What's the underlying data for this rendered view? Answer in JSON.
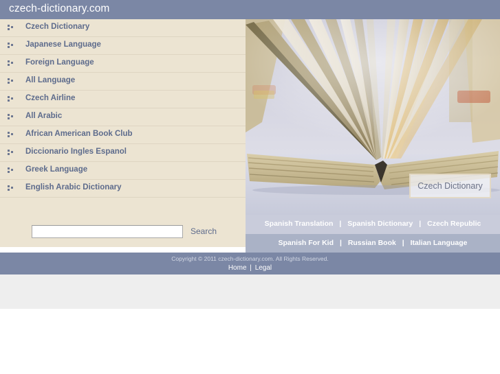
{
  "header": {
    "site_title": "czech-dictionary.com",
    "bar_color": "#7b87a5"
  },
  "sidebar": {
    "background_color": "#ece4d2",
    "bullet_icon": "three-squares-bullet-icon",
    "items": [
      {
        "label": "Czech Dictionary"
      },
      {
        "label": "Japanese Language"
      },
      {
        "label": "Foreign Language"
      },
      {
        "label": "All Language"
      },
      {
        "label": "Czech Airline"
      },
      {
        "label": "All Arabic"
      },
      {
        "label": "African American Book Club"
      },
      {
        "label": "Diccionario Ingles Espanol"
      },
      {
        "label": "Greek Language"
      },
      {
        "label": "English Arabic Dictionary"
      }
    ]
  },
  "search": {
    "value": "",
    "placeholder": "",
    "button_label": "Search"
  },
  "hero": {
    "image_alt": "open-book-fanned-pages-photo",
    "badge_label": "Czech Dictionary"
  },
  "link_rows": [
    {
      "background_color": "#c9ccdb",
      "links": [
        "Spanish Translation",
        "Spanish Dictionary",
        "Czech Republic"
      ],
      "separator": "|"
    },
    {
      "background_color": "#aab2c6",
      "links": [
        "Spanish For Kid",
        "Russian Book",
        "Italian Language"
      ],
      "separator": "|"
    }
  ],
  "footer": {
    "copyright": "Copyright © 2011 czech-dictionary.com. All Rights Reserved.",
    "links": [
      "Home",
      "Legal"
    ],
    "separator": "|",
    "bar_color": "#7b87a5"
  }
}
